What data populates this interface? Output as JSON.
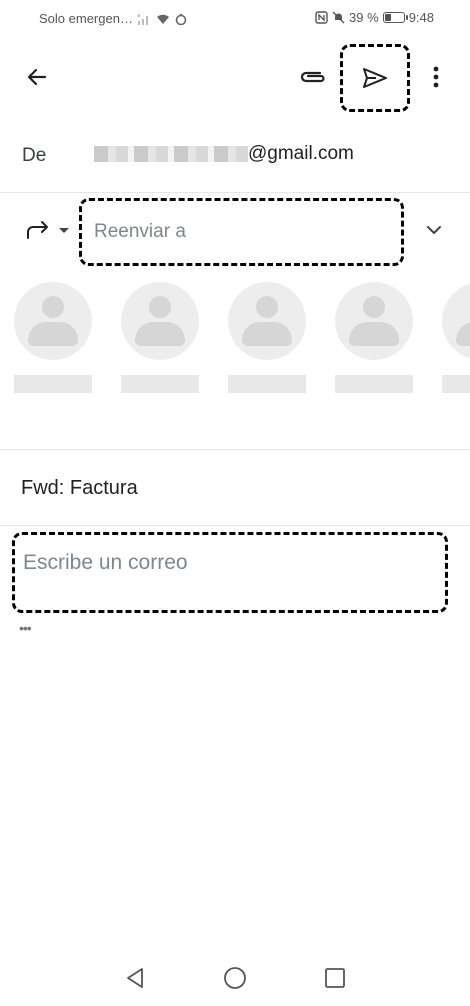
{
  "status_bar": {
    "carrier": "Solo emergen…",
    "battery_percent": "39 %",
    "battery_level": 0.39,
    "time": "9:48"
  },
  "compose": {
    "from_label": "De",
    "from_email_suffix": "@gmail.com",
    "to_placeholder": "Reenviar a",
    "subject": "Fwd: Factura",
    "body_placeholder": "Escribe un correo",
    "quoted_text_toggle": "•••"
  },
  "icons": {
    "back": "arrow-left-icon",
    "attach": "paperclip-icon",
    "send": "send-icon",
    "more": "more-vertical-icon",
    "forward": "forward-icon",
    "expand": "chevron-down-icon"
  }
}
